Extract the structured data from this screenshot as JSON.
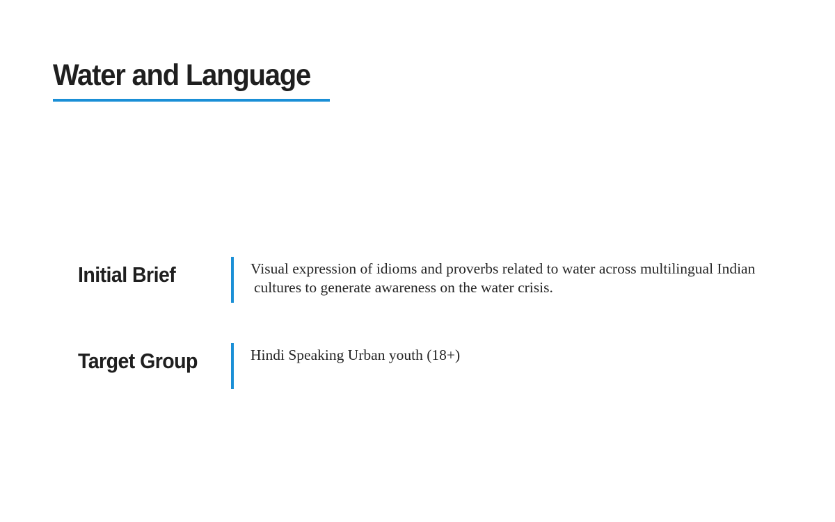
{
  "colors": {
    "accent": "#1a8fd6",
    "text": "#1f1f1f"
  },
  "header": {
    "title": "Water and Language"
  },
  "sections": [
    {
      "label": "Initial Brief",
      "text_lines": [
        "Visual expression of idioms and proverbs related to water across multilingual Indian",
        "cultures to generate awareness on the water crisis."
      ]
    },
    {
      "label": "Target Group",
      "text_lines": [
        "Hindi Speaking Urban youth (18+)"
      ]
    }
  ]
}
